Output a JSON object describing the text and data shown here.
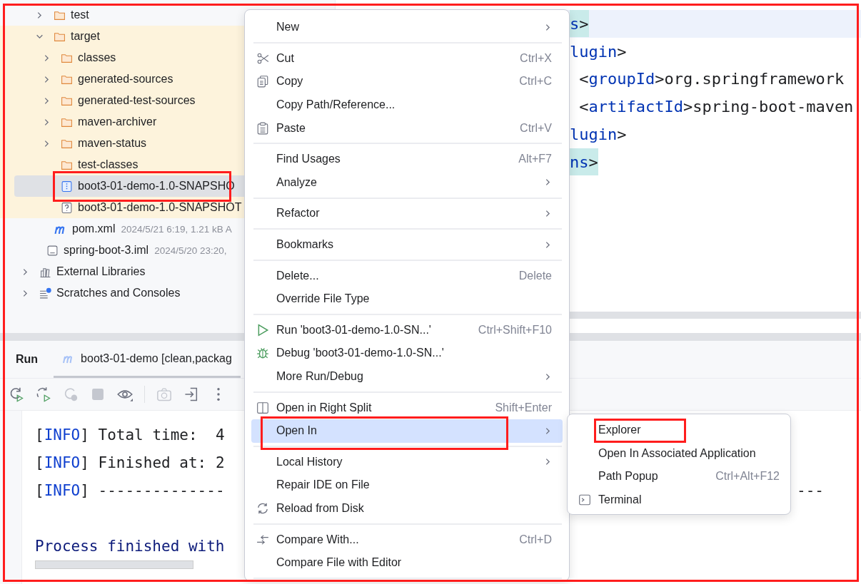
{
  "project_tree": [
    {
      "label": "test",
      "kind": "folder",
      "expanded": false,
      "selected": false
    },
    {
      "label": "target",
      "kind": "folder",
      "expanded": true,
      "selected": false,
      "excluded": true,
      "children": [
        {
          "label": "classes",
          "kind": "folder",
          "expanded": false,
          "selected": false
        },
        {
          "label": "generated-sources",
          "kind": "folder",
          "expanded": false,
          "selected": false
        },
        {
          "label": "generated-test-sources",
          "kind": "folder",
          "expanded": false,
          "selected": false
        },
        {
          "label": "maven-archiver",
          "kind": "folder",
          "expanded": false,
          "selected": false
        },
        {
          "label": "maven-status",
          "kind": "folder",
          "expanded": false,
          "selected": false
        },
        {
          "label": "test-classes",
          "kind": "folder",
          "selected": false
        },
        {
          "label": "boot3-01-demo-1.0-SNAPSHO",
          "kind": "archive",
          "selected": true
        },
        {
          "label": "boot3-01-demo-1.0-SNAPSHOT",
          "kind": "unknown",
          "selected": false
        }
      ]
    },
    {
      "label": "pom.xml",
      "kind": "maven",
      "selected": false,
      "meta": "2024/5/21 6:19, 1.21 kB A"
    },
    {
      "label": "spring-boot-3.iml",
      "kind": "module",
      "selected": false,
      "meta": "2024/5/20 23:20,"
    },
    {
      "label": "External Libraries",
      "kind": "library",
      "expanded": false,
      "selected": false
    },
    {
      "label": "Scratches and Consoles",
      "kind": "scratches",
      "expanded": false,
      "selected": false
    }
  ],
  "editor": {
    "lines": [
      {
        "current": true,
        "matched": true,
        "segments": [
          {
            "text": "s",
            "kind": "tag"
          },
          {
            "text": ">",
            "kind": "plain"
          }
        ]
      },
      {
        "current": false,
        "matched": false,
        "segments": [
          {
            "text": "lugin",
            "kind": "tag"
          },
          {
            "text": ">",
            "kind": "plain"
          }
        ]
      },
      {
        "current": false,
        "matched": false,
        "segments": [
          {
            "text": " <",
            "kind": "plain"
          },
          {
            "text": "groupId",
            "kind": "tag"
          },
          {
            "text": ">org.springframework",
            "kind": "plain"
          }
        ]
      },
      {
        "current": false,
        "matched": false,
        "segments": [
          {
            "text": " <",
            "kind": "plain"
          },
          {
            "text": "artifactId",
            "kind": "tag"
          },
          {
            "text": ">spring-boot-maven",
            "kind": "plain"
          }
        ]
      },
      {
        "current": false,
        "matched": false,
        "segments": [
          {
            "text": "lugin",
            "kind": "tag"
          },
          {
            "text": ">",
            "kind": "plain"
          }
        ]
      },
      {
        "current": false,
        "matched": true,
        "segments": [
          {
            "text": "ns",
            "kind": "tag"
          },
          {
            "text": ">",
            "kind": "plain"
          }
        ]
      }
    ]
  },
  "run_panel": {
    "title": "Run",
    "tabs": [
      {
        "label": "boot3-01-demo [clean,packag",
        "selected": true
      }
    ],
    "toolbar": [
      {
        "disabled": false
      },
      {
        "disabled": false
      },
      {
        "disabled": true
      },
      {
        "disabled": true
      },
      {
        "disabled": false
      },
      {
        "disabled": true
      },
      {
        "disabled": false
      },
      {
        "disabled": false
      }
    ],
    "console": [
      {
        "segments": [
          {
            "text": "[",
            "kind": "plain"
          },
          {
            "text": "INFO",
            "kind": "level"
          },
          {
            "text": "] Total time:  4",
            "kind": "plain"
          }
        ]
      },
      {
        "segments": [
          {
            "text": "[",
            "kind": "plain"
          },
          {
            "text": "INFO",
            "kind": "level"
          },
          {
            "text": "] Finished at: 2",
            "kind": "plain"
          }
        ]
      },
      {
        "segments": [
          {
            "text": "[",
            "kind": "plain"
          },
          {
            "text": "INFO",
            "kind": "level"
          },
          {
            "text": "] --------------",
            "kind": "plain"
          }
        ],
        "tail": "---"
      },
      {
        "segments": [
          {
            "text": "Process finished with",
            "kind": "status"
          }
        ]
      }
    ]
  },
  "context_menu": {
    "items": [
      {
        "kind": "item",
        "label": "New",
        "submenu": true,
        "selected": false
      },
      {
        "kind": "separator"
      },
      {
        "kind": "item",
        "label": "Cut",
        "shortcut": "Ctrl+X",
        "submenu": false,
        "selected": false
      },
      {
        "kind": "item",
        "label": "Copy",
        "shortcut": "Ctrl+C",
        "submenu": false,
        "selected": false
      },
      {
        "kind": "item",
        "label": "Copy Path/Reference...",
        "submenu": false,
        "selected": false
      },
      {
        "kind": "item",
        "label": "Paste",
        "shortcut": "Ctrl+V",
        "submenu": false,
        "selected": false
      },
      {
        "kind": "separator"
      },
      {
        "kind": "item",
        "label": "Find Usages",
        "shortcut": "Alt+F7",
        "submenu": false,
        "selected": false
      },
      {
        "kind": "item",
        "label": "Analyze",
        "submenu": true,
        "selected": false
      },
      {
        "kind": "separator"
      },
      {
        "kind": "item",
        "label": "Refactor",
        "submenu": true,
        "selected": false
      },
      {
        "kind": "separator"
      },
      {
        "kind": "item",
        "label": "Bookmarks",
        "submenu": true,
        "selected": false
      },
      {
        "kind": "separator"
      },
      {
        "kind": "item",
        "label": "Delete...",
        "shortcut": "Delete",
        "submenu": false,
        "selected": false
      },
      {
        "kind": "item",
        "label": "Override File Type",
        "submenu": false,
        "selected": false
      },
      {
        "kind": "separator"
      },
      {
        "kind": "item",
        "label": "Run 'boot3-01-demo-1.0-SN...'",
        "shortcut": "Ctrl+Shift+F10",
        "submenu": false,
        "selected": false
      },
      {
        "kind": "item",
        "label": "Debug 'boot3-01-demo-1.0-SN...'",
        "submenu": false,
        "selected": false
      },
      {
        "kind": "item",
        "label": "More Run/Debug",
        "submenu": true,
        "selected": false
      },
      {
        "kind": "separator"
      },
      {
        "kind": "item",
        "label": "Open in Right Split",
        "shortcut": "Shift+Enter",
        "submenu": false,
        "selected": false
      },
      {
        "kind": "item",
        "label": "Open In",
        "submenu": true,
        "selected": true
      },
      {
        "kind": "separator"
      },
      {
        "kind": "item",
        "label": "Local History",
        "submenu": true,
        "selected": false
      },
      {
        "kind": "item",
        "label": "Repair IDE on File",
        "submenu": false,
        "selected": false
      },
      {
        "kind": "item",
        "label": "Reload from Disk",
        "submenu": false,
        "selected": false
      },
      {
        "kind": "separator"
      },
      {
        "kind": "item",
        "label": "Compare With...",
        "shortcut": "Ctrl+D",
        "submenu": false,
        "selected": false
      },
      {
        "kind": "item",
        "label": "Compare File with Editor",
        "submenu": false,
        "selected": false
      },
      {
        "kind": "separator"
      }
    ]
  },
  "submenu": {
    "items": [
      {
        "label": "Explorer"
      },
      {
        "label": "Open In Associated Application"
      },
      {
        "label": "Path Popup",
        "shortcut": "Ctrl+Alt+F12"
      },
      {
        "label": "Terminal"
      }
    ]
  }
}
